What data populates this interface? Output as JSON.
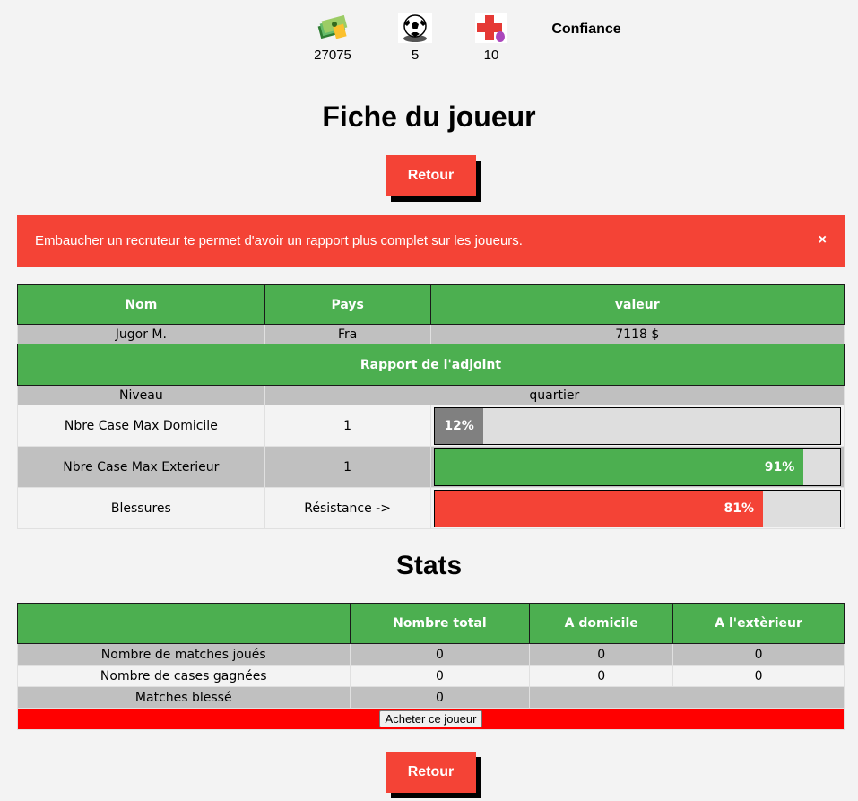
{
  "resources": {
    "money": "27075",
    "balls": "5",
    "health": "10",
    "confidence_label": "Confiance"
  },
  "page_title": "Fiche du joueur",
  "retour_label": "Retour",
  "alert": {
    "message": "Embaucher un recruteur te permet d'avoir un rapport plus complet sur les joueurs.",
    "close": "×"
  },
  "player": {
    "headers": {
      "name": "Nom",
      "country": "Pays",
      "value": "valeur"
    },
    "name": "Jugor M.",
    "country": "Fra",
    "value": "7118 $",
    "report_title": "Rapport de l'adjoint",
    "level_label": "Niveau",
    "level_value": "quartier",
    "rows": [
      {
        "label": "Nbre Case Max Domicile",
        "value": "1",
        "percent": 12,
        "percent_label": "12%",
        "color": "#808080"
      },
      {
        "label": "Nbre Case Max Exterieur",
        "value": "1",
        "percent": 91,
        "percent_label": "91%",
        "color": "#4caf50"
      },
      {
        "label": "Blessures",
        "value": "Résistance ->",
        "percent": 81,
        "percent_label": "81%",
        "color": "#f44336"
      }
    ]
  },
  "stats": {
    "title": "Stats",
    "headers": {
      "blank": "",
      "total": "Nombre total",
      "home": "A domicile",
      "away": "A l'extèrieur"
    },
    "matches": {
      "label": "Nombre de matches joués",
      "total": "0",
      "home": "0",
      "away": "0"
    },
    "cases": {
      "label": "Nombre de cases gagnées",
      "total": "0",
      "home": "0",
      "away": "0"
    },
    "injured": {
      "label": "Matches blessé",
      "total": "0"
    },
    "buy_label": "Acheter ce joueur"
  },
  "colors": {
    "accent": "#f44336",
    "green": "#4caf50",
    "buy_bar": "#ff0000"
  }
}
